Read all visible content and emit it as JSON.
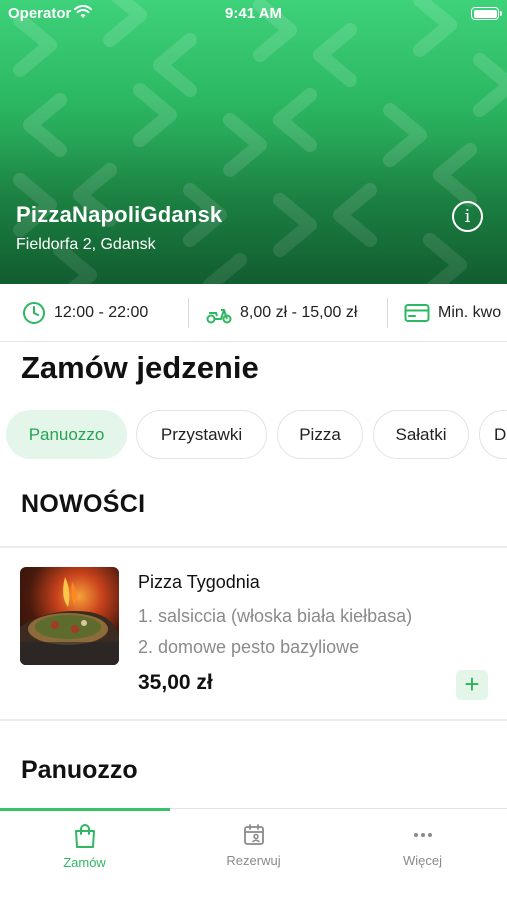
{
  "status_bar": {
    "carrier": "Operator",
    "time": "9:41 AM"
  },
  "restaurant": {
    "name": "PizzaNapoliGdansk",
    "address": "Fieldorfa 2, Gdansk",
    "info_icon": "info-icon"
  },
  "info_strip": {
    "hours": "12:00 - 22:00",
    "delivery_fee": "8,00 zł - 15,00 zł",
    "min_order": "Min. kwo"
  },
  "page_title": "Zamów jedzenie",
  "categories": [
    "Panuozzo",
    "Przystawki",
    "Pizza",
    "Sałatki",
    "D"
  ],
  "selected_category": "Panuozzo",
  "sections": {
    "news": "NOWOŚCI",
    "panuozzo": "Panuozzo"
  },
  "product": {
    "name": "Pizza Tygodnia",
    "desc_line_1": "1. salsiccia (włoska biała kiełbasa)",
    "desc_line_2": "2. domowe pesto bazyliowe",
    "price": "35,00 zł",
    "add_label": "+"
  },
  "tabs": [
    {
      "label": "Zamów",
      "icon": "shopping-bag-icon",
      "active": true
    },
    {
      "label": "Rezerwuj",
      "icon": "calendar-person-icon",
      "active": false
    },
    {
      "label": "Więcej",
      "icon": "more-dots-icon",
      "active": false
    }
  ],
  "colors": {
    "brand_green": "#2cb862",
    "chip_active_bg": "#e4f6ea"
  }
}
